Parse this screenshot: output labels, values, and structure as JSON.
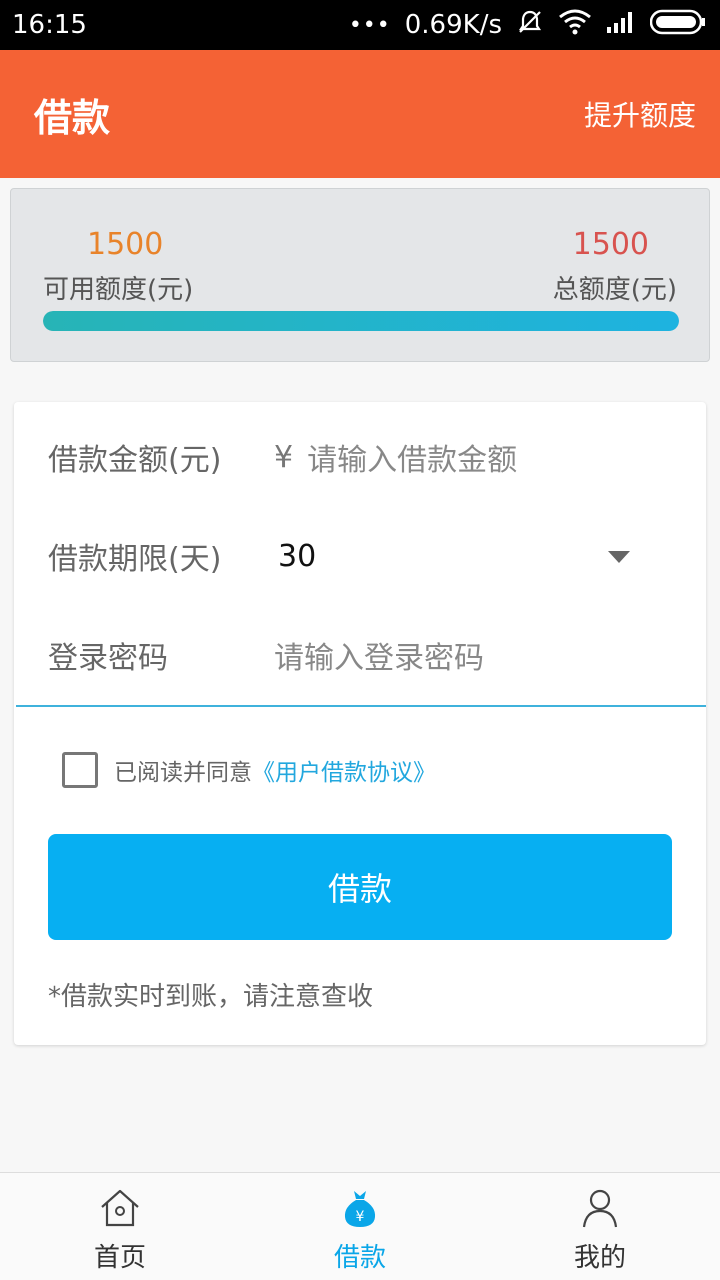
{
  "status_bar": {
    "time": "16:15",
    "dots": "•••",
    "net_speed": "0.69K/s",
    "icons": [
      "mute-icon",
      "wifi-icon",
      "signal-icon",
      "battery-icon"
    ]
  },
  "header": {
    "title": "借款",
    "action": "提升额度",
    "color": "#f46235"
  },
  "credit": {
    "available_value": "1500",
    "available_label": "可用额度(元)",
    "total_value": "1500",
    "total_label": "总额度(元)",
    "progress_fraction": 1.0
  },
  "form": {
    "amount_label": "借款金额(元)",
    "amount_currency": "¥",
    "amount_placeholder": "请输入借款金额",
    "term_label": "借款期限(天)",
    "term_value": "30",
    "password_label": "登录密码",
    "password_placeholder": "请输入登录密码",
    "agreement_text": "已阅读并同意",
    "agreement_link": "《用户借款协议》",
    "submit_label": "借款",
    "note": "*借款实时到账，请注意查收",
    "accent": "#07aff2"
  },
  "nav": {
    "items": [
      {
        "label": "首页",
        "icon": "home-icon",
        "active": false
      },
      {
        "label": "借款",
        "icon": "money-bag-icon",
        "active": true
      },
      {
        "label": "我的",
        "icon": "person-icon",
        "active": false
      }
    ]
  }
}
